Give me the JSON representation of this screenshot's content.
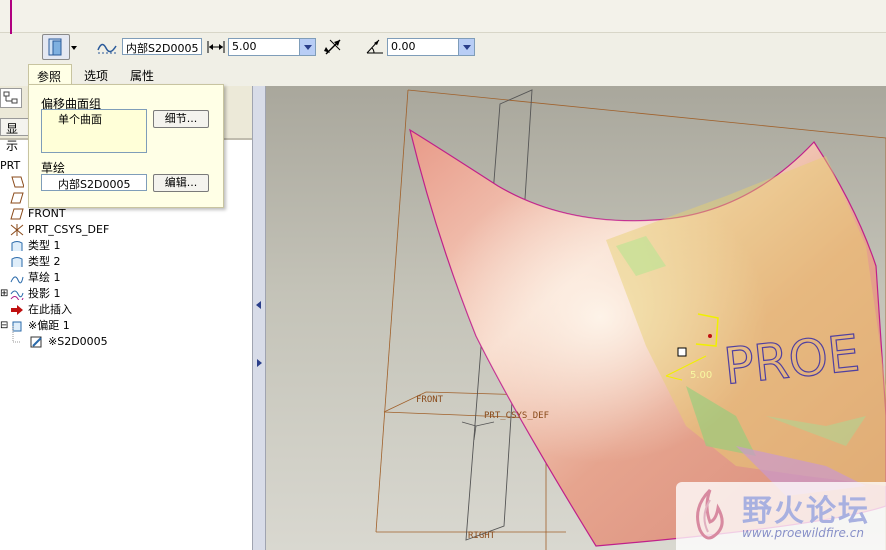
{
  "dashboard": {
    "sketch_field": "内部S2D0005",
    "depth_value": "5.00",
    "angle_value": "0.00",
    "tabs": [
      {
        "label": "参照"
      },
      {
        "label": "选项"
      },
      {
        "label": "属性"
      }
    ]
  },
  "references_panel": {
    "offset_surface_group_label": "偏移曲面组",
    "offset_surface_item": "单个曲面",
    "details_button": "细节...",
    "sketch_label": "草绘",
    "sketch_value": "内部S2D0005",
    "edit_button": "编辑..."
  },
  "model_tree": {
    "show_label": "显示",
    "root": "PRT",
    "items": [
      {
        "label": "",
        "icon": "datum-plane-icon"
      },
      {
        "label": "",
        "icon": "datum-plane-icon"
      },
      {
        "label": "FRONT",
        "icon": "datum-plane-icon"
      },
      {
        "label": "PRT_CSYS_DEF",
        "icon": "csys-icon"
      },
      {
        "label": "类型 1",
        "icon": "surface-icon"
      },
      {
        "label": "类型 2",
        "icon": "surface-icon"
      },
      {
        "label": "草绘 1",
        "icon": "sketch-icon"
      },
      {
        "label": "投影 1",
        "icon": "projection-icon"
      },
      {
        "label": "在此插入",
        "icon": "insert-here-arrow-icon"
      },
      {
        "label": "※偏距 1",
        "icon": "offset-feature-icon"
      },
      {
        "label": "※S2D0005",
        "icon": "section-icon"
      }
    ]
  },
  "graphics": {
    "datum_labels": {
      "front": "FRONT",
      "csys": "PRT_CSYS_DEF",
      "right": "RIGHT"
    },
    "embossed_text": "PROE",
    "dimension_value": "5.00",
    "colors": {
      "surface": "#e8a090",
      "highlight_edge": "#c0208a",
      "datum": "#a0602a",
      "text_curve": "#5040a0"
    }
  },
  "watermark": {
    "title": "野火论坛",
    "url": "www.proewildfire.cn"
  }
}
